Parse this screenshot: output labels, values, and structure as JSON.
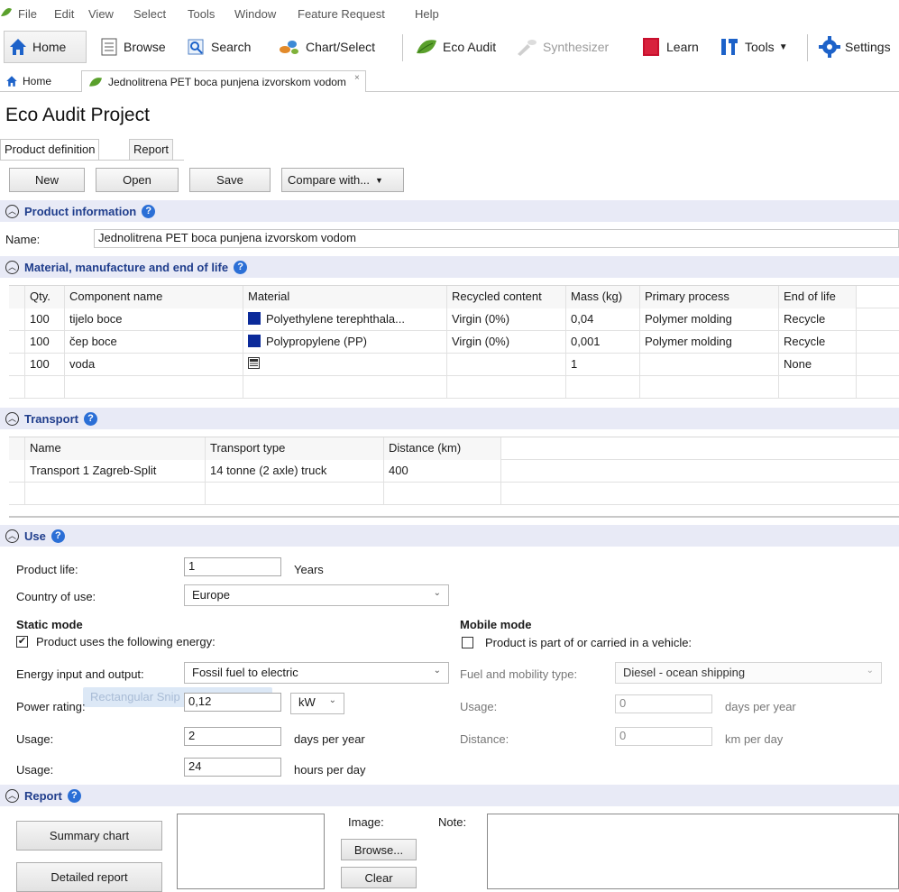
{
  "menu": [
    "File",
    "Edit",
    "View",
    "Select",
    "Tools",
    "Window",
    "Feature Request",
    "Help"
  ],
  "toolbar": {
    "home": "Home",
    "browse": "Browse",
    "search": "Search",
    "chart_select": "Chart/Select",
    "eco_audit": "Eco Audit",
    "synthesizer": "Synthesizer",
    "learn": "Learn",
    "tools": "Tools",
    "settings": "Settings"
  },
  "doc_tabs": {
    "home": "Home",
    "document": "Jednolitrena PET boca punjena izvorskom vodom",
    "close": "×"
  },
  "title": "Eco Audit Project",
  "inner_tabs": {
    "product_definition": "Product definition",
    "report": "Report"
  },
  "actions": {
    "new": "New",
    "open": "Open",
    "save": "Save",
    "compare": "Compare with..."
  },
  "product_info": {
    "header": "Product information",
    "name_label": "Name:",
    "name_value": "Jednolitrena PET boca punjena izvorskom vodom"
  },
  "materials": {
    "header": "Material, manufacture and end of life",
    "columns": [
      "Qty.",
      "Component name",
      "Material",
      "Recycled content",
      "Mass (kg)",
      "Primary process",
      "End of life"
    ],
    "rows": [
      {
        "qty": "100",
        "name": "tijelo boce",
        "material": "Polyethylene terephthala...",
        "recycled": "Virgin (0%)",
        "mass": "0,04",
        "process": "Polymer molding",
        "eol": "Recycle"
      },
      {
        "qty": "100",
        "name": "čep boce",
        "material": "Polypropylene (PP)",
        "recycled": "Virgin (0%)",
        "mass": "0,001",
        "process": "Polymer molding",
        "eol": "Recycle"
      },
      {
        "qty": "100",
        "name": "voda",
        "material": "",
        "recycled": "",
        "mass": "1",
        "process": "",
        "eol": "None"
      }
    ]
  },
  "transport": {
    "header": "Transport",
    "columns": [
      "Name",
      "Transport type",
      "Distance (km)"
    ],
    "rows": [
      {
        "name": "Transport 1 Zagreb-Split",
        "type": "14 tonne (2 axle) truck",
        "distance": "400"
      }
    ]
  },
  "use": {
    "header": "Use",
    "product_life_label": "Product life:",
    "product_life_value": "1",
    "product_life_unit": "Years",
    "country_label": "Country of use:",
    "country_value": "Europe",
    "static_mode": "Static mode",
    "static_check_label": "Product uses the following energy:",
    "static_checked": true,
    "energy_label": "Energy input and output:",
    "energy_value": "Fossil fuel to electric",
    "power_label": "Power rating:",
    "power_value": "0,12",
    "power_unit": "kW",
    "usage_label": "Usage:",
    "usage_days_value": "2",
    "usage_days_unit": "days per year",
    "usage_hours_value": "24",
    "usage_hours_unit": "hours per day",
    "mobile_mode": "Mobile mode",
    "mobile_check_label": "Product is part of or carried in a vehicle:",
    "mobile_checked": false,
    "fuel_label": "Fuel and mobility type:",
    "fuel_value": "Diesel - ocean shipping",
    "mobile_usage_label": "Usage:",
    "mobile_usage_value": "0",
    "mobile_usage_unit": "days per year",
    "distance_label": "Distance:",
    "distance_value": "0",
    "distance_unit": "km per day",
    "tooltip": "Rectangular Snip"
  },
  "report": {
    "header": "Report",
    "summary_chart": "Summary chart",
    "detailed_report": "Detailed report",
    "image_label": "Image:",
    "browse": "Browse...",
    "clear": "Clear",
    "note_label": "Note:"
  },
  "colors": {
    "section_bg": "#e8eaf6",
    "section_title": "#1f3d8c",
    "help_blue": "#2b6fd6",
    "material_swatch": "#0b2a9a",
    "eco_green": "#5aa02c"
  }
}
